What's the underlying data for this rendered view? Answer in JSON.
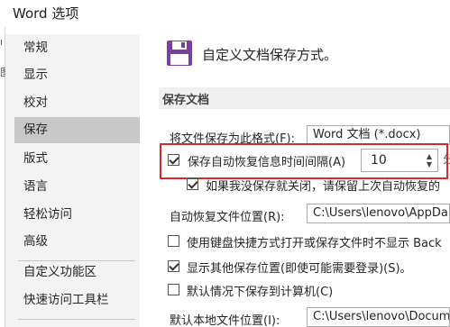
{
  "window": {
    "title": "Word 选项"
  },
  "edge_fragments": [
    "ı",
    "图"
  ],
  "sidebar": {
    "items": [
      {
        "label": "常规"
      },
      {
        "label": "显示"
      },
      {
        "label": "校对"
      },
      {
        "label": "保存",
        "active": true
      },
      {
        "label": "版式"
      },
      {
        "label": "语言"
      },
      {
        "label": "轻松访问"
      },
      {
        "label": "高级"
      },
      {
        "label": "自定义功能区"
      },
      {
        "label": "快速访问工具栏"
      }
    ]
  },
  "header": {
    "icon": "floppy-disk-icon",
    "text": "自定义文档保存方式。"
  },
  "section": {
    "title": "保存文档"
  },
  "options": {
    "save_format": {
      "label": "将文件保存为此格式(F):",
      "value": "Word 文档 (*.docx)"
    },
    "autorecover": {
      "label": "保存自动恢复信息时间间隔(A)",
      "checked": true,
      "value": "10",
      "trailing": "分"
    },
    "keep_last": {
      "label": "如果我没保存就关闭，请保留上次自动恢复的",
      "checked": true
    },
    "autorecover_location": {
      "label": "自动恢复文件位置(R):",
      "value": "C:\\Users\\lenovo\\AppDa"
    },
    "shortcut_option": {
      "label": "使用键盘快捷方式打开或保存文件时不显示 Back",
      "checked": false
    },
    "show_other": {
      "label": "显示其他保存位置(即使可能需要登录)(S)。",
      "checked": true
    },
    "default_local": {
      "label": "默认情况下保存到计算机(C)",
      "checked": false
    },
    "default_local_location": {
      "label": "默认本地文件位置(I):",
      "value": "C:\\Users\\lenovo\\Docum"
    }
  },
  "colors": {
    "highlight": "#d62b2b",
    "accent": "#7b3fa0",
    "sidebar_active": "#c8c8c8"
  }
}
